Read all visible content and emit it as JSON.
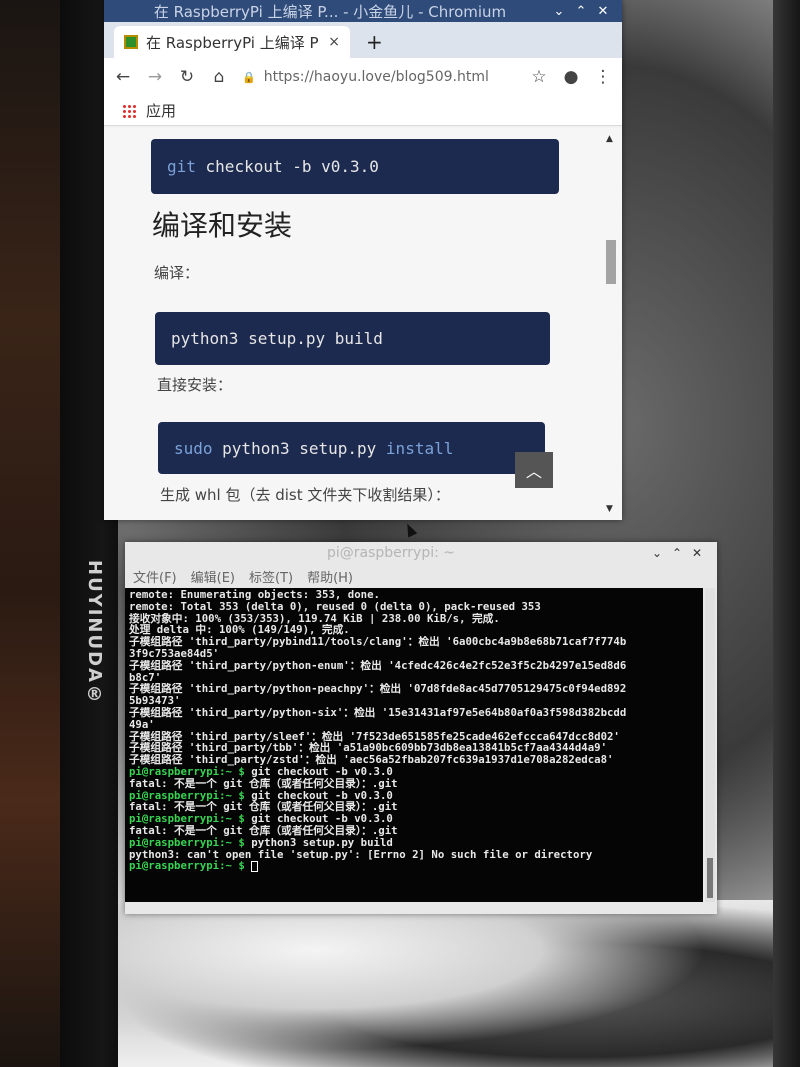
{
  "monitor": {
    "brand": "HUYINUDA®"
  },
  "browser": {
    "window_title": "在 RaspberryPi 上编译 P... - 小金鱼儿 - Chromium",
    "tab_title": "在 RaspberryPi 上编译 P",
    "tab_close": "×",
    "new_tab": "+",
    "url": "https://haoyu.love/blog509.html",
    "bookmarks_apps": "应用",
    "title_controls": {
      "minimize": "⌄",
      "maximize": "⌃",
      "close": "✕"
    }
  },
  "page": {
    "code1": {
      "kw": "git",
      "rest": " checkout -b v0.3.0"
    },
    "heading": "编译和安装",
    "compile_label": "编译：",
    "code2": "python3 setup.py build",
    "install_label": "直接安装：",
    "code3": {
      "kw1": "sudo",
      "mid": " python3 setup.py ",
      "kw2": "install"
    },
    "whl_label": "生成 whl 包（去 dist 文件夹下收割结果）："
  },
  "terminal": {
    "title": "pi@raspberrypi: ~",
    "menu": [
      "文件(F)",
      "编辑(E)",
      "标签(T)",
      "帮助(H)"
    ],
    "lines": [
      {
        "prompt": "",
        "text": "remote: Enumerating objects: 353, done."
      },
      {
        "prompt": "",
        "text": "remote: Total 353 (delta 0), reused 0 (delta 0), pack-reused 353"
      },
      {
        "prompt": "",
        "text": "接收对象中: 100% (353/353), 119.74 KiB | 238.00 KiB/s, 完成."
      },
      {
        "prompt": "",
        "text": "处理 delta 中: 100% (149/149), 完成."
      },
      {
        "prompt": "",
        "text": "子模组路径 'third_party/pybind11/tools/clang'：检出 '6a00cbc4a9b8e68b71caf7f774b"
      },
      {
        "prompt": "",
        "text": "3f9c753ae84d5'"
      },
      {
        "prompt": "",
        "text": "子模组路径 'third_party/python-enum'：检出 '4cfedc426c4e2fc52e3f5c2b4297e15ed8d6"
      },
      {
        "prompt": "",
        "text": "b8c7'"
      },
      {
        "prompt": "",
        "text": "子模组路径 'third_party/python-peachpy'：检出 '07d8fde8ac45d7705129475c0f94ed892"
      },
      {
        "prompt": "",
        "text": "5b93473'"
      },
      {
        "prompt": "",
        "text": "子模组路径 'third_party/python-six'：检出 '15e31431af97e5e64b80af0a3f598d382bcdd"
      },
      {
        "prompt": "",
        "text": "49a'"
      },
      {
        "prompt": "",
        "text": "子模组路径 'third_party/sleef'：检出 '7f523de651585fe25cade462efccca647dcc8d02'"
      },
      {
        "prompt": "",
        "text": "子模组路径 'third_party/tbb'：检出 'a51a90bc609bb73db8ea13841b5cf7aa4344d4a9'"
      },
      {
        "prompt": "",
        "text": "子模组路径 'third_party/zstd'：检出 'aec56a52fbab207fc639a1937d1e708a282edca8'"
      },
      {
        "prompt": "pi@raspberrypi:~ $",
        "text": " git checkout -b v0.3.0"
      },
      {
        "prompt": "",
        "text": "fatal: 不是一个 git 仓库（或者任何父目录）：.git"
      },
      {
        "prompt": "pi@raspberrypi:~ $",
        "text": " git checkout -b v0.3.0"
      },
      {
        "prompt": "",
        "text": "fatal: 不是一个 git 仓库（或者任何父目录）：.git"
      },
      {
        "prompt": "pi@raspberrypi:~ $",
        "text": " git checkout -b v0.3.0"
      },
      {
        "prompt": "",
        "text": "fatal: 不是一个 git 仓库（或者任何父目录）：.git"
      },
      {
        "prompt": "pi@raspberrypi:~ $",
        "text": " python3 setup.py build"
      },
      {
        "prompt": "",
        "text": "python3: can't open file 'setup.py': [Errno 2] No such file or directory"
      },
      {
        "prompt": "pi@raspberrypi:~ $",
        "text": " "
      }
    ]
  },
  "colors": {
    "prompt": "#39d353",
    "code_bg": "#1d2a4f",
    "titlebar": "#2f4b7a"
  }
}
